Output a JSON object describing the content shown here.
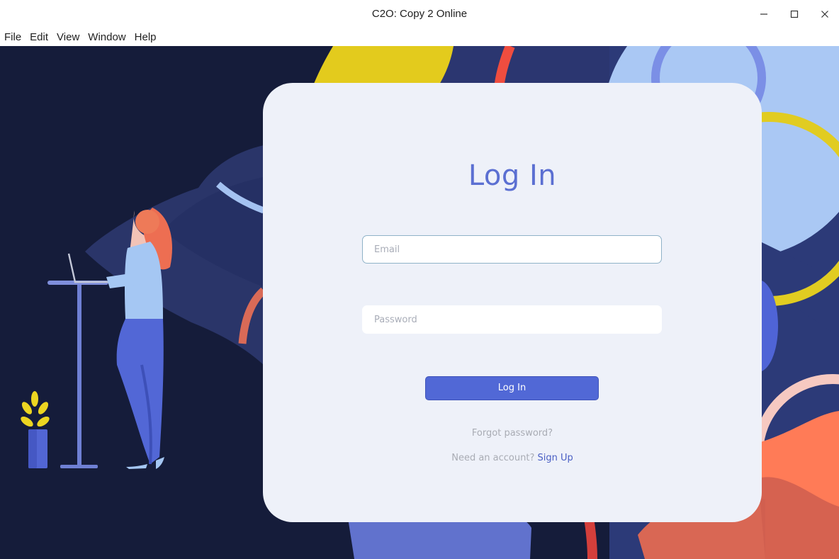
{
  "window": {
    "title": "C2O: Copy 2 Online",
    "controls": {
      "minimize_icon": "minimize-icon",
      "maximize_icon": "maximize-icon",
      "close_icon": "close-icon"
    }
  },
  "menubar": {
    "items": [
      "File",
      "Edit",
      "View",
      "Window",
      "Help"
    ]
  },
  "login": {
    "title": "Log In",
    "email": {
      "value": "",
      "placeholder": "Email"
    },
    "password": {
      "value": "",
      "placeholder": "Password"
    },
    "submit_label": "Log In",
    "forgot_label": "Forgot password?",
    "signup_prompt": "Need an account?",
    "signup_link": "Sign Up"
  },
  "colors": {
    "background": "#151c3a",
    "card": "#eef1f9",
    "accent": "#5168d6",
    "title": "#5b6fd2",
    "muted_text": "#a9acb4"
  }
}
